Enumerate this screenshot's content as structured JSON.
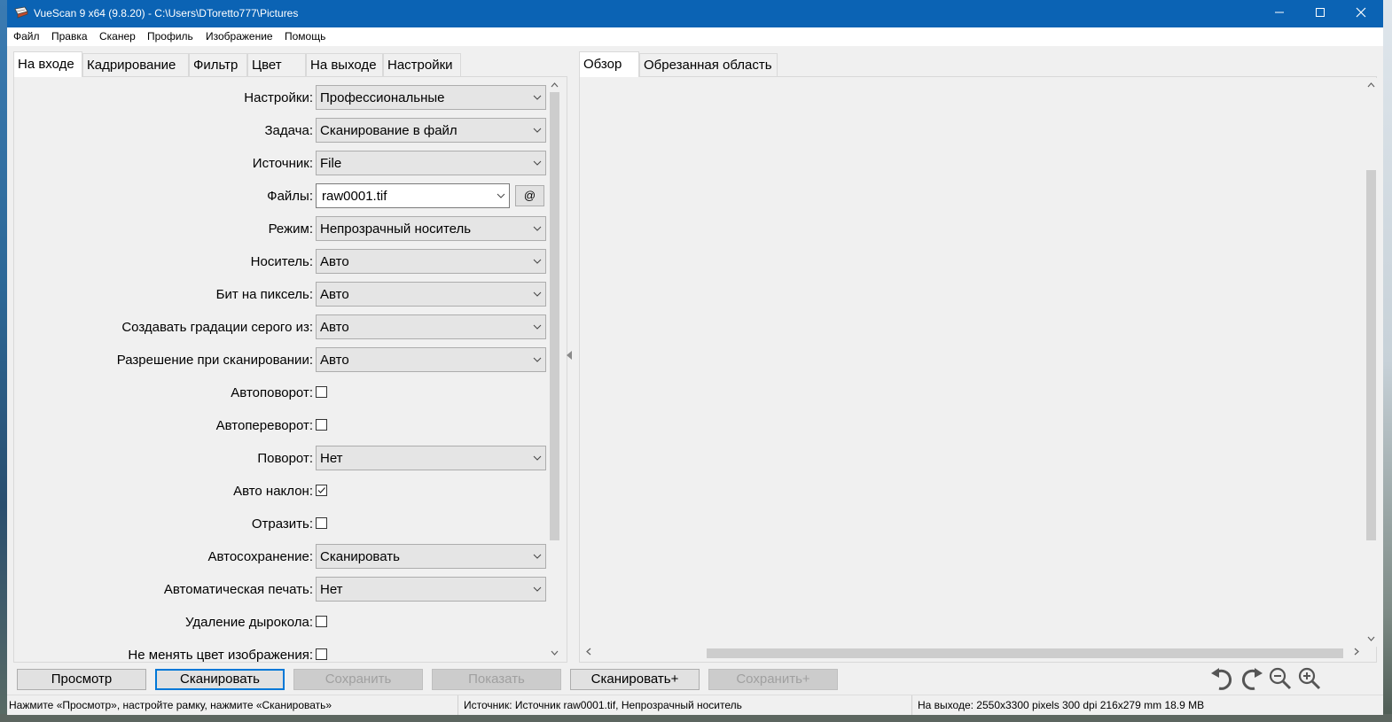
{
  "window": {
    "title": "VueScan 9 x64 (9.8.20) - C:\\Users\\DToretto777\\Pictures",
    "minimize": "—",
    "maximize": "☐",
    "close": "✕"
  },
  "menu": [
    "Файл",
    "Правка",
    "Сканер",
    "Профиль",
    "Изображение",
    "Помощь"
  ],
  "left_tabs": [
    "На входе",
    "Кадрирование",
    "Фильтр",
    "Цвет",
    "На выходе",
    "Настройки"
  ],
  "right_tabs": [
    "Обзор",
    "Обрезанная область"
  ],
  "form": {
    "settings": {
      "label": "Настройки:",
      "value": "Профессиональные"
    },
    "task": {
      "label": "Задача:",
      "value": "Сканирование в файл"
    },
    "source": {
      "label": "Источник:",
      "value": "File"
    },
    "files": {
      "label": "Файлы:",
      "value": "raw0001.tif",
      "button": "@"
    },
    "mode": {
      "label": "Режим:",
      "value": "Непрозрачный носитель"
    },
    "media": {
      "label": "Носитель:",
      "value": "Авто"
    },
    "bits": {
      "label": "Бит на пиксель:",
      "value": "Авто"
    },
    "gray": {
      "label": "Создавать градации серого из:",
      "value": "Авто"
    },
    "resolution": {
      "label": "Разрешение при сканировании:",
      "value": "Авто"
    },
    "autorotate": {
      "label": "Автоповорот:",
      "checked": false
    },
    "autoflip": {
      "label": "Автопереворот:",
      "checked": false
    },
    "rotation": {
      "label": "Поворот:",
      "value": "Нет"
    },
    "autoskew": {
      "label": "Авто наклон:",
      "checked": true
    },
    "mirror": {
      "label": "Отразить:",
      "checked": false
    },
    "autosave": {
      "label": "Автосохранение:",
      "value": "Сканировать"
    },
    "autoprint": {
      "label": "Автоматическая печать:",
      "value": "Нет"
    },
    "holepunch": {
      "label": "Удаление дырокола:",
      "checked": false
    },
    "keepcolor": {
      "label": "Не менять цвет изображения:",
      "checked": false
    }
  },
  "buttons": {
    "preview": "Просмотр",
    "scan": "Сканировать",
    "save": "Сохранить",
    "show": "Показать",
    "scan_plus": "Сканировать+",
    "save_plus": "Сохранить+"
  },
  "status": {
    "hint": "Нажмите «Просмотр», настройте рамку, нажмите «Сканировать»",
    "source": "Источник: Источник raw0001.tif, Непрозрачный носитель",
    "output": "На выходе: 2550x3300 pixels 300 dpi 216x279 mm 18.9 MB"
  },
  "icons": [
    "app-icon",
    "rotate-left-icon",
    "rotate-right-icon",
    "zoom-out-icon",
    "zoom-in-icon"
  ]
}
